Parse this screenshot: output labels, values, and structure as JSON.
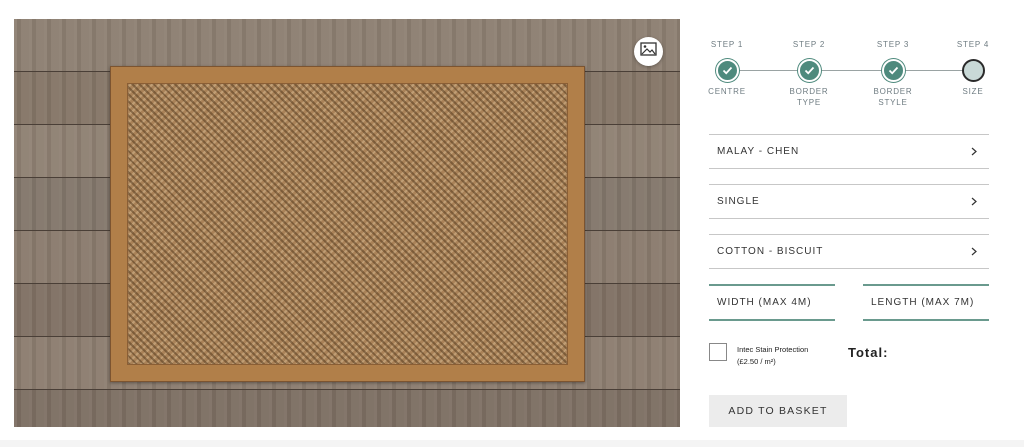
{
  "preview": {
    "image_icon": "image-icon",
    "colors": {
      "floor": "#8a7a6c",
      "rug_border": "#b17f49",
      "rug_weave": "#a98258"
    }
  },
  "steps": [
    {
      "label": "STEP 1",
      "name": "CENTRE",
      "status": "done"
    },
    {
      "label": "STEP 2",
      "name": "BORDER TYPE",
      "status": "done"
    },
    {
      "label": "STEP 3",
      "name": "BORDER STYLE",
      "status": "done"
    },
    {
      "label": "STEP 4",
      "name": "SIZE",
      "status": "current"
    }
  ],
  "selectors": [
    {
      "value": "MALAY - CHEN"
    },
    {
      "value": "SINGLE"
    },
    {
      "value": "COTTON - BISCUIT"
    }
  ],
  "dimensions": {
    "width_placeholder": "WIDTH (MAX 4M)",
    "length_placeholder": "LENGTH (MAX 7M)"
  },
  "stain_protection": {
    "line1": "Intec Stain Protection",
    "line2": "(£2.50 / m²)",
    "checked": false
  },
  "total_label": "Total:",
  "add_to_basket": "ADD TO BASKET",
  "colors": {
    "accent": "#4e8a7d",
    "field_border": "#6a9a8e",
    "current_step": "#c9d9d7"
  }
}
